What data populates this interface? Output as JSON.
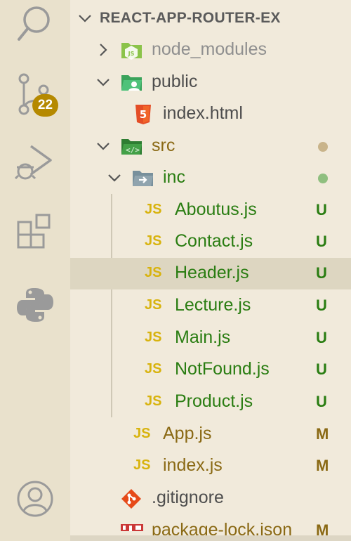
{
  "activity_bar": {
    "source_control_badge": "22",
    "items": [
      "search-icon",
      "source-control-icon",
      "run-debug-icon",
      "extensions-icon",
      "python-icon",
      "account-icon"
    ]
  },
  "explorer": {
    "project_name": "REACT-APP-ROUTER-EX",
    "items": [
      {
        "label": "node_modules",
        "status": ""
      },
      {
        "label": "public",
        "status": ""
      },
      {
        "label": "index.html",
        "status": ""
      },
      {
        "label": "src",
        "status": ""
      },
      {
        "label": "inc",
        "status": ""
      },
      {
        "label": "Aboutus.js",
        "status": "U"
      },
      {
        "label": "Contact.js",
        "status": "U"
      },
      {
        "label": "Header.js",
        "status": "U"
      },
      {
        "label": "Lecture.js",
        "status": "U"
      },
      {
        "label": "Main.js",
        "status": "U"
      },
      {
        "label": "NotFound.js",
        "status": "U"
      },
      {
        "label": "Product.js",
        "status": "U"
      },
      {
        "label": "App.js",
        "status": "M"
      },
      {
        "label": "index.js",
        "status": "M"
      },
      {
        "label": ".gitignore",
        "status": ""
      },
      {
        "label": "package-lock.json",
        "status": "M"
      }
    ],
    "js_icon_text": "JS",
    "colors": {
      "untracked": "#2a7d12",
      "modified": "#8a6914",
      "badge": "#b58900",
      "selected_row": "#ddd6c1"
    }
  }
}
